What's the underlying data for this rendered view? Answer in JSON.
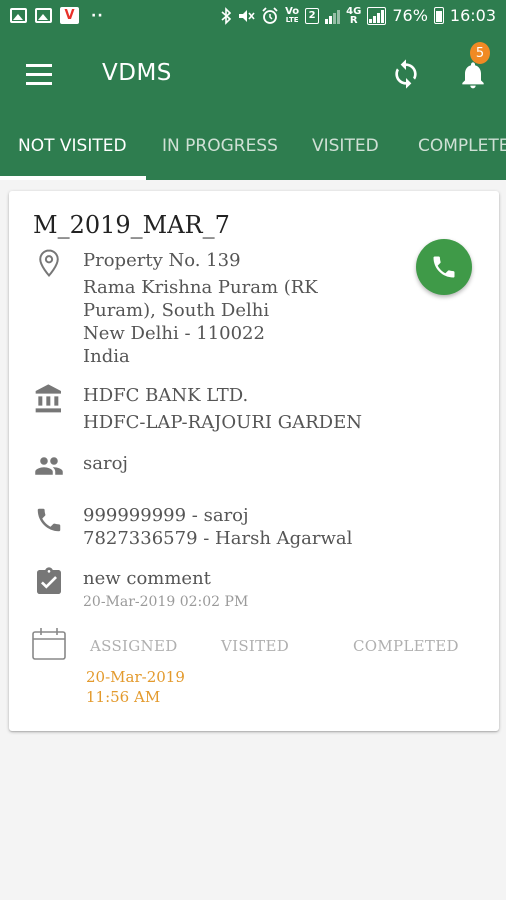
{
  "status_bar": {
    "app_badge": "V",
    "overflow": "··",
    "volte_top": "Vo",
    "volte_bottom": "LTE",
    "sim": "2",
    "net_top": "4G",
    "net_bottom": "R",
    "battery": "76%",
    "time": "16:03"
  },
  "app_bar": {
    "title": "VDMS",
    "menu_icon": "hamburger-icon",
    "sync_icon": "sync-icon",
    "bell_icon": "bell-icon",
    "notification_count": "5",
    "color": "#2e7d4f",
    "badge_color": "#f08a24"
  },
  "tabs": [
    {
      "label": "NOT VISITED",
      "active": true
    },
    {
      "label": "IN PROGRESS",
      "active": false
    },
    {
      "label": "VISITED",
      "active": false
    },
    {
      "label": "COMPLETED",
      "active": false
    }
  ],
  "case": {
    "id": "M_2019_MAR_7",
    "address": {
      "icon": "location-pin-icon",
      "lines": [
        "Property No. 139",
        "Rama Krishna Puram (RK",
        "Puram), South Delhi",
        "New Delhi - 110022",
        "India"
      ]
    },
    "bank": {
      "icon": "bank-icon",
      "lines": [
        "HDFC BANK LTD.",
        "HDFC-LAP-RAJOURI GARDEN"
      ]
    },
    "contact_person": {
      "icon": "people-icon",
      "name": "saroj"
    },
    "phones": {
      "icon": "phone-icon",
      "lines": [
        "999999999 - saroj",
        "7827336579 - Harsh Agarwal"
      ]
    },
    "comment": {
      "icon": "checklist-icon",
      "text": "new comment",
      "timestamp": "20-Mar-2019 02:02 PM"
    },
    "timeline": {
      "icon": "calendar-icon",
      "headers": [
        "ASSIGNED",
        "VISITED",
        "COMPLETED"
      ],
      "assigned_date": "20-Mar-2019",
      "assigned_time": "11:56 AM",
      "accent": "#e39a2d"
    },
    "call_button_icon": "call-icon",
    "call_color": "#3f9a48"
  }
}
